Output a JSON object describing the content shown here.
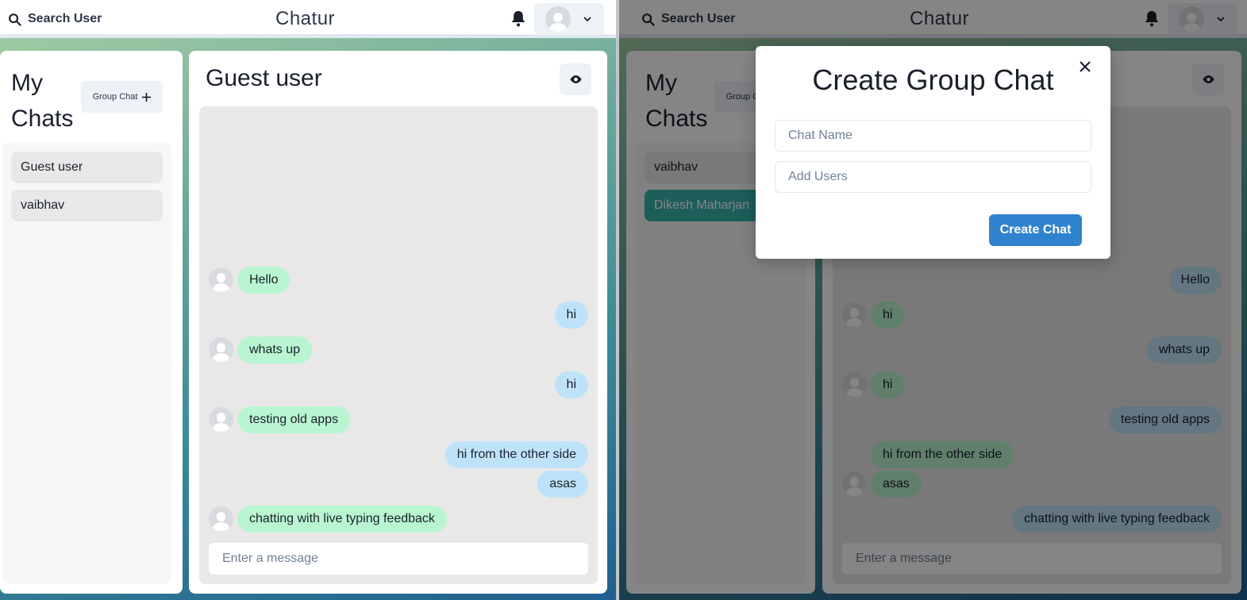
{
  "app": {
    "title": "Chatur",
    "search_label": "Search User"
  },
  "colors": {
    "sent_bubble": "#bee3f8",
    "received_bubble": "#b9f5d0",
    "active_chat": "#38b2ac",
    "primary_button": "#3182ce"
  },
  "left_window": {
    "sidebar": {
      "title": "My Chats",
      "group_chat_button": "Group Chat",
      "chats": [
        {
          "name": "Guest user",
          "active": false
        },
        {
          "name": "vaibhav",
          "active": false
        }
      ]
    },
    "chat": {
      "title": "Guest user",
      "messages": [
        {
          "text": "Hello",
          "direction": "in",
          "show_avatar": true
        },
        {
          "text": "hi",
          "direction": "out",
          "show_avatar": false
        },
        {
          "text": "whats up",
          "direction": "in",
          "show_avatar": true
        },
        {
          "text": "hi",
          "direction": "out",
          "show_avatar": false
        },
        {
          "text": "testing old apps",
          "direction": "in",
          "show_avatar": true
        },
        {
          "text": "hi from the other side",
          "direction": "out",
          "show_avatar": false
        },
        {
          "text": "asas",
          "direction": "out",
          "show_avatar": false
        },
        {
          "text": "chatting with live typing feedback",
          "direction": "in",
          "show_avatar": true
        }
      ],
      "input_placeholder": "Enter a message"
    }
  },
  "right_window": {
    "sidebar": {
      "title": "My Chats",
      "group_chat_button": "Group Chat",
      "chats": [
        {
          "name": "vaibhav",
          "active": false
        },
        {
          "name": "Dikesh Maharjan",
          "active": true
        }
      ]
    },
    "chat": {
      "messages": [
        {
          "text": "Hello",
          "direction": "out",
          "show_avatar": false
        },
        {
          "text": "hi",
          "direction": "in",
          "show_avatar": true
        },
        {
          "text": "whats up",
          "direction": "out",
          "show_avatar": false
        },
        {
          "text": "hi",
          "direction": "in",
          "show_avatar": true
        },
        {
          "text": "testing old apps",
          "direction": "out",
          "show_avatar": false
        },
        {
          "text": "hi from the other side",
          "direction": "in",
          "show_avatar": false
        },
        {
          "text": "asas",
          "direction": "in",
          "show_avatar": true
        },
        {
          "text": "chatting with live typing feedback",
          "direction": "out",
          "show_avatar": false
        }
      ],
      "input_placeholder": "Enter a message"
    },
    "modal": {
      "title": "Create Group Chat",
      "chat_name_placeholder": "Chat Name",
      "add_users_placeholder": "Add Users",
      "submit_label": "Create Chat"
    }
  }
}
